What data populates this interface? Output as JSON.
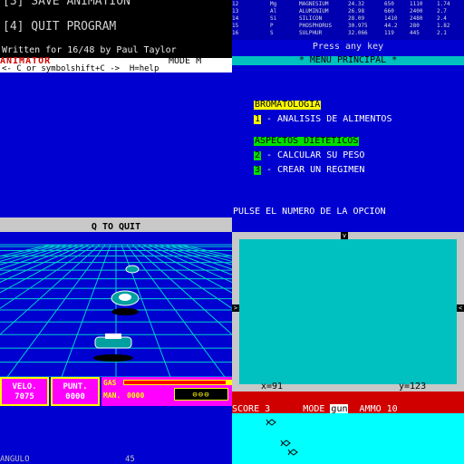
{
  "animation_menu": {
    "options": [
      "[3] SAVE ANIMATION",
      "[4] QUIT PROGRAM"
    ],
    "credit": "Written for 16/48 by Paul Taylor",
    "title_strip": "ANIMATOR",
    "mode": "MODE M",
    "help": "<- C or symbolshift+C ->  H=help"
  },
  "element_table": {
    "rows": [
      [
        "12",
        "Mg",
        "MAGNESIUM",
        "24.32",
        "650",
        "1110",
        "1.74"
      ],
      [
        "13",
        "Al",
        "ALUMINIUM",
        "26.98",
        "660",
        "2400",
        "2.7"
      ],
      [
        "14",
        "Si",
        "SILICON",
        "28.09",
        "1410",
        "2480",
        "2.4"
      ],
      [
        "15",
        "P",
        "PHOSPHORUS",
        "30.975",
        "44.2",
        "280",
        "1.82"
      ],
      [
        "16",
        "S",
        "SULPHUR",
        "32.066",
        "119",
        "445",
        "2.1"
      ]
    ],
    "press_any_key": "Press any key"
  },
  "diet_menu": {
    "title": "* MENU PRINCIPAL *",
    "category1": "BROMATOLOGIA",
    "category2": "ASPECTOS DIETETICOS",
    "options": [
      {
        "num": "1",
        "label": "- ANALISIS DE ALIMENTOS"
      },
      {
        "num": "2",
        "label": "- CALCULAR SU PESO"
      },
      {
        "num": "3",
        "label": "- CREAR UN REGIMEN"
      }
    ],
    "prompt": "PULSE EL NUMERO DE LA OPCION"
  },
  "racing": {
    "quit": "Q TO QUIT",
    "velo_label": "VELO.",
    "velo_value": "7075",
    "punt_label": "PUNT.",
    "punt_value": "0000",
    "gas_label": "GAS",
    "gas_level": 0.95,
    "man_label": "MAN.",
    "man_value": "0000",
    "lives": "⊖⊖⊖",
    "angulo_label": "ANGULO",
    "angulo_value": "45"
  },
  "gun_game": {
    "x_readout": "x=91",
    "y_readout": "y=123",
    "score_label": "SCORE",
    "score_value": "3",
    "mode_label": "MODE",
    "mode_value": "gun",
    "ammo_label": "AMMO",
    "ammo_value": "10"
  },
  "colors": {
    "spectrum_blue": "#0000d0",
    "spectrum_cyan": "#00c0c0",
    "spectrum_yellow": "#ffff00",
    "spectrum_magenta": "#ff00ff",
    "spectrum_red": "#d00000"
  }
}
